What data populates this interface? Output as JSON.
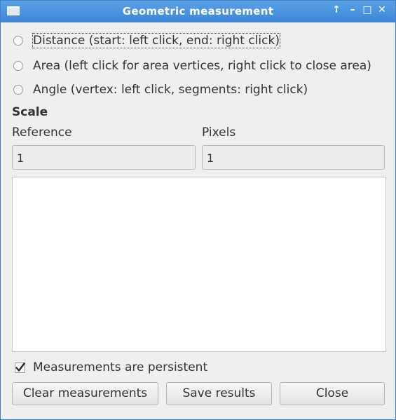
{
  "window": {
    "title": "Geometric measurement",
    "controls": {
      "up": "↑",
      "minimize": "–",
      "maximize": "□",
      "close": "✕"
    }
  },
  "modes": [
    {
      "label": "Distance (start: left click, end: right click)",
      "selected": false,
      "focused": true
    },
    {
      "label": "Area (left click for area vertices, right click to close area)",
      "selected": false
    },
    {
      "label": "Angle (vertex: left click, segments: right click)",
      "selected": false
    }
  ],
  "scale": {
    "title": "Scale",
    "reference_label": "Reference",
    "reference_value": "1",
    "pixels_label": "Pixels",
    "pixels_value": "1"
  },
  "persistent": {
    "label": "Measurements are persistent",
    "checked": true
  },
  "buttons": {
    "clear": "Clear measurements",
    "save": "Save results",
    "close": "Close"
  },
  "colors": {
    "titlebar": "#4a93de",
    "window_bg": "#efefef"
  }
}
